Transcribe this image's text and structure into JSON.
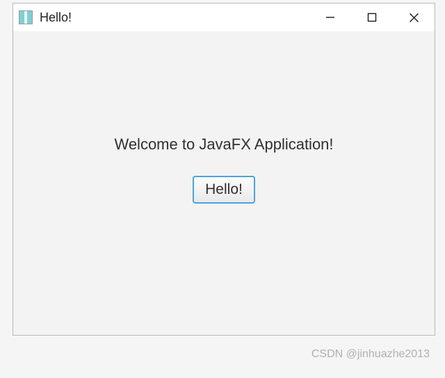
{
  "window": {
    "title": "Hello!"
  },
  "content": {
    "welcome_text": "Welcome to JavaFX Application!",
    "button_label": "Hello!"
  },
  "watermark": {
    "text": "CSDN @jinhuazhe2013"
  }
}
